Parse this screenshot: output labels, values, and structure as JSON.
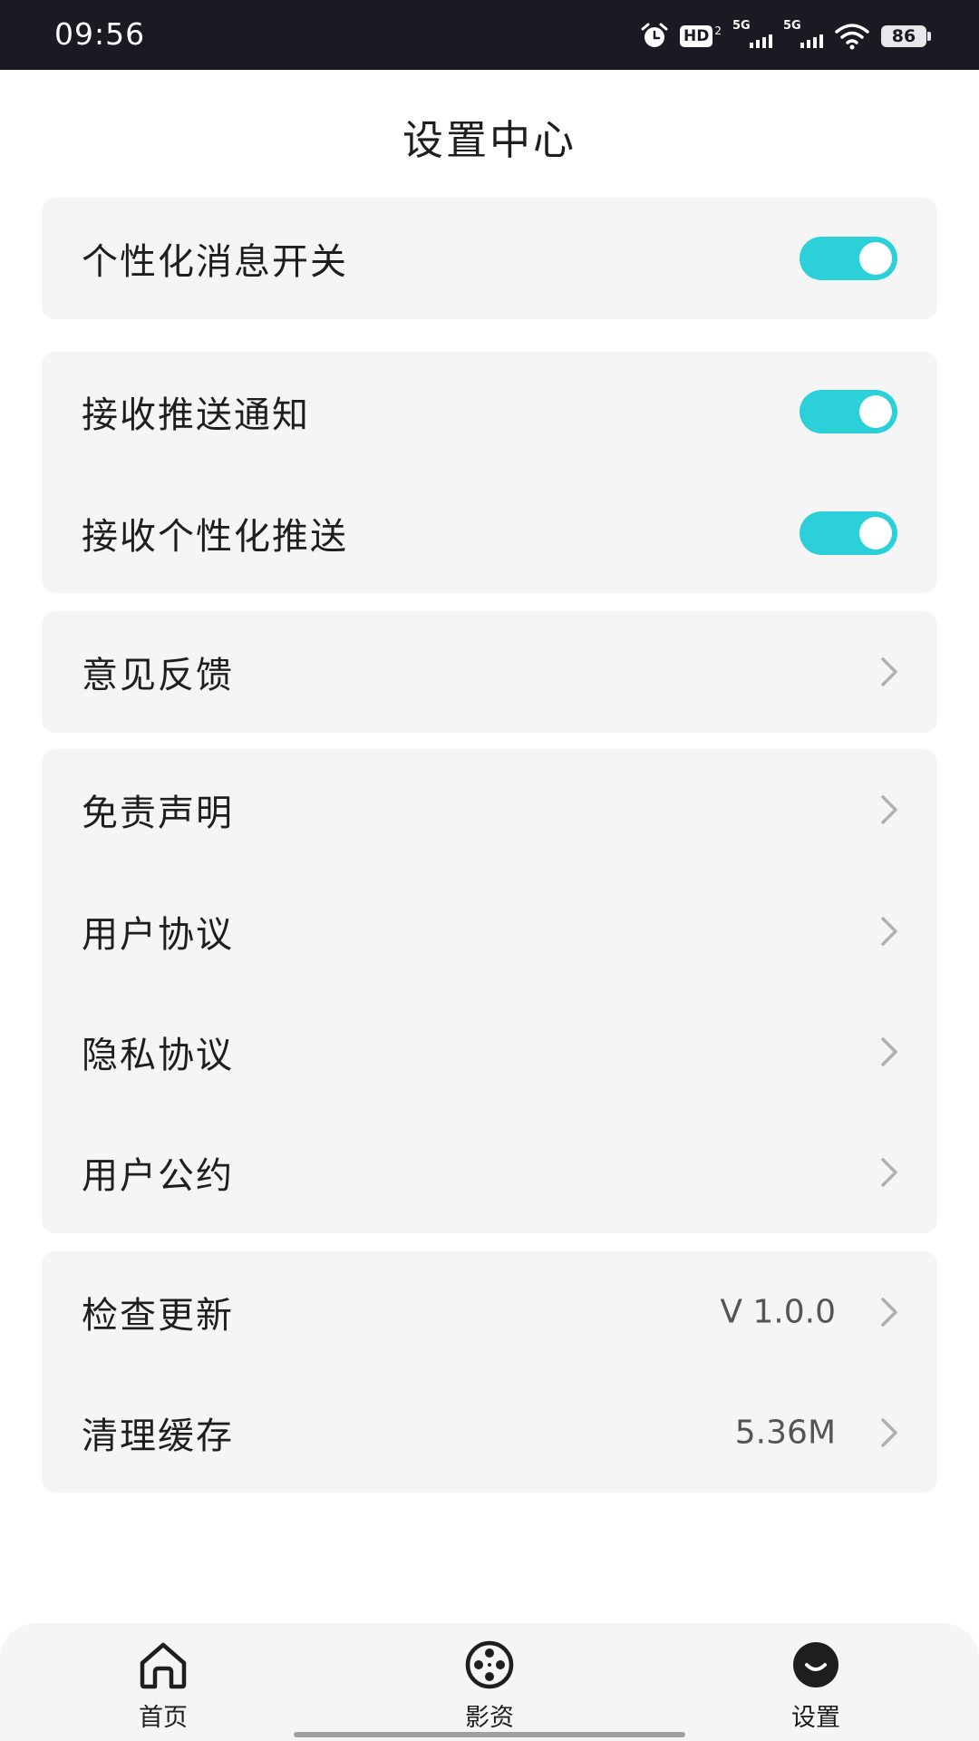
{
  "status_bar": {
    "time": "09:56",
    "hd_label": "HD",
    "hd_sub": "2",
    "signal1_label": "5G",
    "signal2_label": "5G",
    "battery": "86",
    "icons": [
      "alarm-icon",
      "hd-icon",
      "signal-5g-icon",
      "signal-5g-icon",
      "wifi-icon",
      "battery-icon"
    ]
  },
  "header": {
    "title": "设置中心"
  },
  "groups": [
    {
      "rows": [
        {
          "label": "个性化消息开关",
          "control": "toggle",
          "on": true
        }
      ]
    },
    {
      "rows": [
        {
          "label": "接收推送通知",
          "control": "toggle",
          "on": true
        },
        {
          "label": "接收个性化推送",
          "control": "toggle",
          "on": true
        }
      ]
    },
    {
      "rows": [
        {
          "label": "意见反馈",
          "control": "chevron"
        }
      ]
    },
    {
      "rows": [
        {
          "label": "免责声明",
          "control": "chevron"
        },
        {
          "label": "用户协议",
          "control": "chevron"
        },
        {
          "label": "隐私协议",
          "control": "chevron"
        },
        {
          "label": "用户公约",
          "control": "chevron"
        }
      ]
    },
    {
      "rows": [
        {
          "label": "检查更新",
          "value": "V 1.0.0",
          "control": "chevron"
        },
        {
          "label": "清理缓存",
          "value": "5.36M",
          "control": "chevron"
        }
      ]
    }
  ],
  "tabbar": {
    "tabs": [
      {
        "label": "首页",
        "icon": "home-icon",
        "active": false
      },
      {
        "label": "影资",
        "icon": "film-reel-icon",
        "active": false
      },
      {
        "label": "设置",
        "icon": "settings-face-icon",
        "active": true
      }
    ]
  },
  "colors": {
    "accent": "#2cd0d8",
    "status_bar_bg": "#1a1b22",
    "card_bg": "#f5f5f5",
    "text": "#1e1e1e",
    "chevron": "#b0b0b0"
  }
}
